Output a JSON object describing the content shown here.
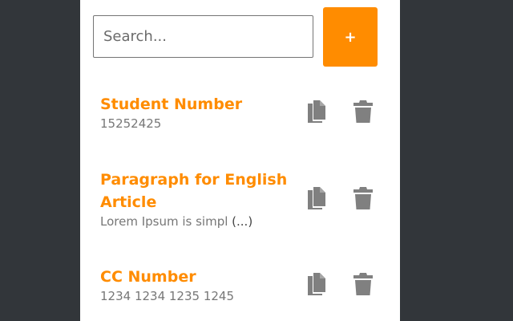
{
  "search": {
    "placeholder": "Search..."
  },
  "add_button": {
    "label": "+"
  },
  "snippets": [
    {
      "title": "Student Number",
      "value": "15252425",
      "more": ""
    },
    {
      "title": "Paragraph for English Article",
      "value": "Lorem Ipsum is simpl ",
      "more": "(...)"
    },
    {
      "title": "CC Number",
      "value": "1234 1234 1235 1245",
      "more": ""
    }
  ],
  "colors": {
    "accent": "#ff8c00",
    "background": "#32363a",
    "icon": "#808080"
  }
}
